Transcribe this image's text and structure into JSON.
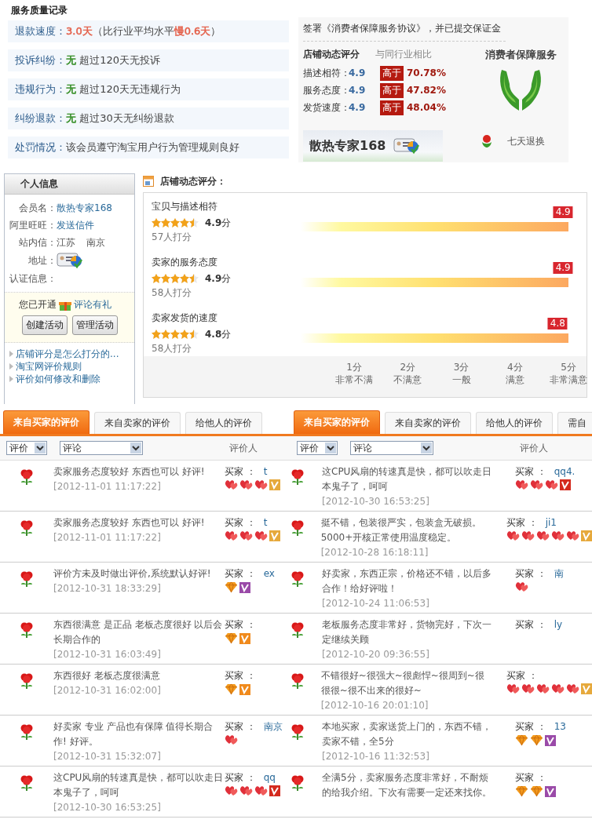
{
  "service_record": {
    "title": "服务质量记录",
    "rows": [
      {
        "label": "退款速度：",
        "parts": [
          {
            "text": "3.0天",
            "color": "#e4604a"
          },
          {
            "text": "（比行业平均水平"
          },
          {
            "text": "慢0.6天",
            "color": "#e4604a"
          },
          {
            "text": "）"
          }
        ]
      },
      {
        "label": "投诉纠纷：",
        "parts": [
          {
            "text": "无",
            "color": "#2e8a1e"
          },
          {
            "text": " 超过120天无投诉"
          }
        ]
      },
      {
        "label": "违规行为：",
        "parts": [
          {
            "text": "无",
            "color": "#2e8a1e"
          },
          {
            "text": " 超过120天无违规行为"
          }
        ]
      },
      {
        "label": "纠纷退款：",
        "parts": [
          {
            "text": "无",
            "color": "#2e8a1e"
          },
          {
            "text": " 超过30天无纠纷退款"
          }
        ]
      },
      {
        "label": "处罚情况：",
        "parts": [
          {
            "text": "该会员遵守淘宝用户行为管理规则良好"
          }
        ]
      }
    ]
  },
  "guarantee": {
    "agreement": "签署《消费者保障服务协议》，并已提交保证金",
    "scores_title": "店铺动态评分",
    "compare_title": "与同行业相比",
    "scores": [
      {
        "label": "描述相符：",
        "value": "4.9",
        "badge": "高于",
        "percent": "70.78%"
      },
      {
        "label": "服务态度：",
        "value": "4.9",
        "badge": "高于",
        "percent": "47.82%"
      },
      {
        "label": "发货速度：",
        "value": "4.9",
        "badge": "高于",
        "percent": "48.04%"
      }
    ],
    "shop_name": "散热专家168",
    "service_title": "消费者保障服务",
    "service_item": "七天退换"
  },
  "profile": {
    "title": "个人信息",
    "fields": [
      {
        "label": "会员名：",
        "kind": "link",
        "value": "散热专家168"
      },
      {
        "label": "阿里旺旺：",
        "kind": "link",
        "value": "发送信件"
      },
      {
        "label": "站内信：",
        "kind": "text",
        "value": "江苏 南京"
      },
      {
        "label": "地址：",
        "kind": "cert"
      },
      {
        "label": "认证信息：",
        "kind": "empty"
      }
    ],
    "promo": {
      "text": "您已开通",
      "link": "评论有礼",
      "buttons": [
        "创建活动",
        "管理活动"
      ]
    },
    "links": [
      "店铺评分是怎么打分的...",
      "淘宝网评价规则",
      "评价如何修改和删除"
    ]
  },
  "dynamic_rating": {
    "title": "店铺动态评分：",
    "items": [
      {
        "label": "宝贝与描述相符",
        "stars": 4.5,
        "score": "**4.9**分",
        "count": "57人打分",
        "marker": "4.9",
        "level": 0.98
      },
      {
        "label": "卖家的服务态度",
        "stars": 4.5,
        "score": "**4.9**分",
        "count": "58人打分",
        "marker": "4.9",
        "level": 0.98
      },
      {
        "label": "卖家发货的速度",
        "stars": 4.5,
        "score": "**4.8**分",
        "count": "58人打分",
        "marker": "4.8",
        "level": 0.96
      }
    ],
    "scale": [
      {
        "score": "1分",
        "meaning": "非常不满"
      },
      {
        "score": "2分",
        "meaning": "不满意"
      },
      {
        "score": "3分",
        "meaning": "一般"
      },
      {
        "score": "4分",
        "meaning": "满意"
      },
      {
        "score": "5分",
        "meaning": "非常满意"
      }
    ]
  },
  "review_panels": [
    {
      "tabs": [
        {
          "label": "来自买家的评价",
          "selected": true
        },
        {
          "label": "来自卖家的评价",
          "selected": false
        },
        {
          "label": "给他人的评价",
          "selected": false
        }
      ],
      "filters": [
        "评价",
        "评论"
      ],
      "column": "评价人",
      "rows": [
        {
          "kind": "good",
          "comment": "卖家服务态度较好 东西也可以 好评!",
          "time": "[2012-11-01 11:17:22]",
          "buyer_label": "买家 ：",
          "buyer": "t",
          "badges": [
            {
              "kind": "heart"
            },
            {
              "kind": "heart"
            },
            {
              "kind": "heart"
            },
            {
              "kind": "vip-gold"
            }
          ]
        },
        {
          "kind": "good",
          "comment": "卖家服务态度较好 东西也可以 好评!",
          "time": "[2012-11-01 11:17:22]",
          "buyer_label": "买家 ：",
          "buyer": "t",
          "badges": [
            {
              "kind": "heart"
            },
            {
              "kind": "heart"
            },
            {
              "kind": "heart"
            },
            {
              "kind": "vip-gold"
            }
          ]
        },
        {
          "kind": "good",
          "comment": "评价方未及时做出评价,系统默认好评!",
          "time": "[2012-10-31 18:33:29]",
          "buyer_label": "买家 ：",
          "buyer": "ex",
          "badges": [
            {
              "kind": "diamond"
            },
            {
              "kind": "vip-purple"
            }
          ]
        },
        {
          "kind": "good",
          "comment": "东西很满意 是正品 老板态度很好 以后会长期合作的",
          "time": "[2012-10-31 16:03:49]",
          "buyer_label": "买家 ：",
          "badges": [
            {
              "kind": "diamond"
            },
            {
              "kind": "vip-orange"
            }
          ]
        },
        {
          "kind": "good",
          "comment": "东西很好 老板态度很满意",
          "time": "[2012-10-31 16:02:00]",
          "buyer_label": "买家 ：",
          "badges": [
            {
              "kind": "diamond"
            },
            {
              "kind": "vip-orange"
            }
          ]
        },
        {
          "kind": "good",
          "comment": "好卖家 专业 产品也有保障 值得长期合作! 好评。",
          "time": "[2012-10-31 15:32:07]",
          "buyer_label": "买家 ：",
          "buyer": "南京",
          "badges": [
            {
              "kind": "heart"
            }
          ]
        },
        {
          "kind": "good",
          "comment": "这CPU风扇的转速真是快，都可以吹走日本鬼子了，呵呵",
          "time": "[2012-10-30 16:53:25]",
          "buyer_label": "买家 ：",
          "buyer": "qq",
          "badges": [
            {
              "kind": "heart"
            },
            {
              "kind": "heart"
            },
            {
              "kind": "heart"
            },
            {
              "kind": "vip-red"
            }
          ]
        }
      ]
    },
    {
      "tabs": [
        {
          "label": "来自买家的评价",
          "selected": true
        },
        {
          "label": "来自卖家的评价",
          "selected": false
        },
        {
          "label": "给他人的评价",
          "selected": false
        },
        {
          "label": "需自",
          "selected": false
        }
      ],
      "filters": [
        "评价",
        "评论"
      ],
      "column": "评价人",
      "rows": [
        {
          "kind": "good",
          "comment": "这CPU风扇的转速真是快，都可以吹走日本鬼子了，呵呵",
          "time": "[2012-10-30 16:53:25]",
          "buyer_label": "买家 ：",
          "buyer": "qq4.",
          "badges": [
            {
              "kind": "heart"
            },
            {
              "kind": "heart"
            },
            {
              "kind": "heart"
            },
            {
              "kind": "vip-red"
            }
          ]
        },
        {
          "kind": "good",
          "comment": "挺不错，包装很严实，包装盒无破损。5000+开核正常使用温度稳定。",
          "time": "[2012-10-28 16:18:11]",
          "buyer_label": "买家 ：",
          "buyer": "ji1",
          "badges": [
            {
              "kind": "heart"
            },
            {
              "kind": "heart"
            },
            {
              "kind": "heart"
            },
            {
              "kind": "heart"
            },
            {
              "kind": "heart"
            },
            {
              "kind": "vip-gold"
            }
          ]
        },
        {
          "kind": "good",
          "comment": "好卖家，东西正宗，价格还不错，以后多合作！给好评啦！",
          "time": "[2012-10-24 11:06:53]",
          "buyer_label": "买家 ：",
          "buyer": "南",
          "badges": [
            {
              "kind": "heart"
            }
          ]
        },
        {
          "kind": "good",
          "comment": "老板服务态度非常好，货物完好，下次一定继续关顾",
          "time": "[2012-10-20 09:36:55]",
          "buyer_label": "买家 ：",
          "buyer": "ly"
        },
        {
          "kind": "good",
          "comment": "不错很好~很强大~很彪悍~很周到~很很很~很不出来的很好~",
          "time": "[2012-10-16 20:01:10]",
          "buyer_label": "买家 ：",
          "badges": [
            {
              "kind": "heart"
            },
            {
              "kind": "heart"
            },
            {
              "kind": "heart"
            },
            {
              "kind": "heart"
            },
            {
              "kind": "heart"
            },
            {
              "kind": "vip-gold"
            }
          ]
        },
        {
          "kind": "good",
          "comment": "本地买家，卖家送货上门的，东西不错，卖家不错，全5分",
          "time": "[2012-10-16 11:32:53]",
          "buyer_label": "买家 ：",
          "buyer": "13",
          "badges": [
            {
              "kind": "diamond"
            },
            {
              "kind": "diamond"
            },
            {
              "kind": "vip-purple"
            }
          ]
        },
        {
          "kind": "good",
          "comment": "全满5分，卖家服务态度非常好，不耐烦的给我介绍。下次有需要一定还来找你。",
          "buyer_label": "买家 ：",
          "badges": [
            {
              "kind": "diamond"
            },
            {
              "kind": "diamond"
            },
            {
              "kind": "vip-purple"
            }
          ]
        }
      ]
    }
  ]
}
